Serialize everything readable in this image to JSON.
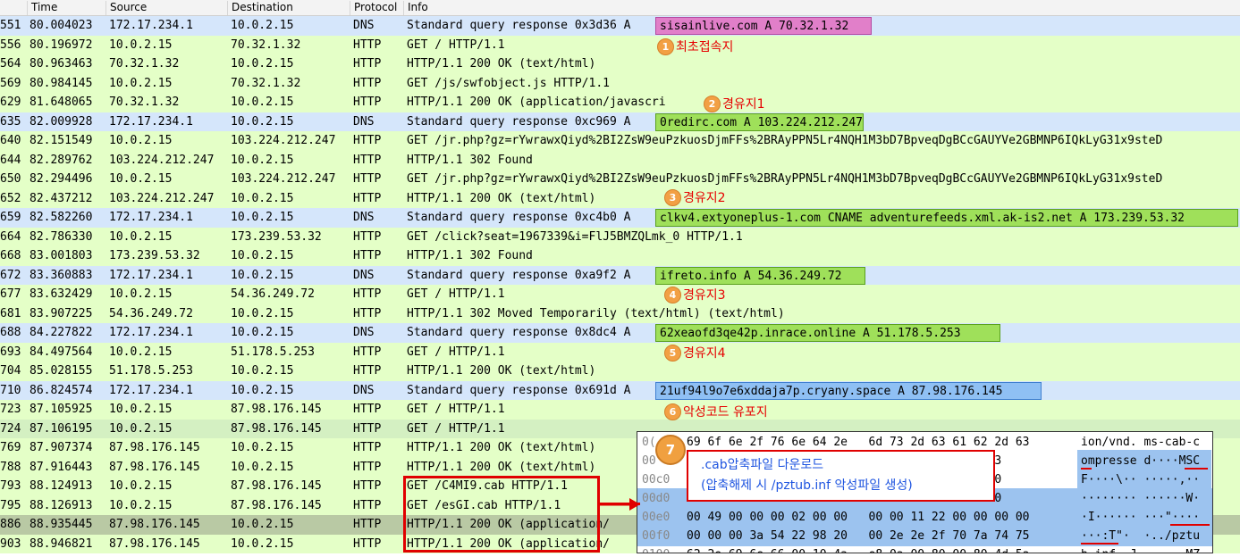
{
  "columns": {
    "no": "",
    "time": "Time",
    "source": "Source",
    "destination": "Destination",
    "protocol": "Protocol",
    "info": "Info"
  },
  "packets": [
    {
      "no": "551",
      "time": "80.004023",
      "src": "172.17.234.1",
      "dst": "10.0.2.15",
      "proto": "DNS",
      "info": "Standard query response 0x3d36 A",
      "hl_text": "sisainlive.com A 70.32.1.32",
      "bg": "#d5e6fb",
      "hl": "pink"
    },
    {
      "no": "556",
      "time": "80.196972",
      "src": "10.0.2.15",
      "dst": "70.32.1.32",
      "proto": "HTTP",
      "info": "GET / HTTP/1.1",
      "bg": "#e4ffc7"
    },
    {
      "no": "564",
      "time": "80.963463",
      "src": "70.32.1.32",
      "dst": "10.0.2.15",
      "proto": "HTTP",
      "info": "HTTP/1.1 200 OK  (text/html)",
      "bg": "#e4ffc7"
    },
    {
      "no": "569",
      "time": "80.984145",
      "src": "10.0.2.15",
      "dst": "70.32.1.32",
      "proto": "HTTP",
      "info": "GET /js/swfobject.js HTTP/1.1",
      "bg": "#e4ffc7"
    },
    {
      "no": "629",
      "time": "81.648065",
      "src": "70.32.1.32",
      "dst": "10.0.2.15",
      "proto": "HTTP",
      "info": "HTTP/1.1 200 OK  (application/javascri",
      "bg": "#e4ffc7"
    },
    {
      "no": "635",
      "time": "82.009928",
      "src": "172.17.234.1",
      "dst": "10.0.2.15",
      "proto": "DNS",
      "info": "Standard query response 0xc969 A",
      "hl_text": "0redirc.com A 103.224.212.247",
      "bg": "#d5e6fb",
      "hl": "green"
    },
    {
      "no": "640",
      "time": "82.151549",
      "src": "10.0.2.15",
      "dst": "103.224.212.247",
      "proto": "HTTP",
      "info": "GET /jr.php?gz=rYwrawxQiyd%2BI2ZsW9euPzkuosDjmFFs%2BRAyPPN5Lr4NQH1M3bD7BpveqDgBCcGAUYVe2GBMNP6IQkLyG31x9steD",
      "bg": "#e4ffc7"
    },
    {
      "no": "644",
      "time": "82.289762",
      "src": "103.224.212.247",
      "dst": "10.0.2.15",
      "proto": "HTTP",
      "info": "HTTP/1.1 302 Found",
      "bg": "#e4ffc7"
    },
    {
      "no": "650",
      "time": "82.294496",
      "src": "10.0.2.15",
      "dst": "103.224.212.247",
      "proto": "HTTP",
      "info": "GET /jr.php?gz=rYwrawxQiyd%2BI2ZsW9euPzkuosDjmFFs%2BRAyPPN5Lr4NQH1M3bD7BpveqDgBCcGAUYVe2GBMNP6IQkLyG31x9steD",
      "bg": "#e4ffc7"
    },
    {
      "no": "652",
      "time": "82.437212",
      "src": "103.224.212.247",
      "dst": "10.0.2.15",
      "proto": "HTTP",
      "info": "HTTP/1.1 200 OK  (text/html)",
      "bg": "#e4ffc7"
    },
    {
      "no": "659",
      "time": "82.582260",
      "src": "172.17.234.1",
      "dst": "10.0.2.15",
      "proto": "DNS",
      "info": "Standard query response 0xc4b0 A",
      "hl_text": "clkv4.extyoneplus-1.com CNAME adventurefeeds.xml.ak-is2.net A 173.239.53.32",
      "bg": "#d5e6fb",
      "hl": "green"
    },
    {
      "no": "664",
      "time": "82.786330",
      "src": "10.0.2.15",
      "dst": "173.239.53.32",
      "proto": "HTTP",
      "info": "GET /click?seat=1967339&i=FlJ5BMZQLmk_0 HTTP/1.1",
      "bg": "#e4ffc7"
    },
    {
      "no": "668",
      "time": "83.001803",
      "src": "173.239.53.32",
      "dst": "10.0.2.15",
      "proto": "HTTP",
      "info": "HTTP/1.1 302 Found",
      "bg": "#e4ffc7"
    },
    {
      "no": "672",
      "time": "83.360883",
      "src": "172.17.234.1",
      "dst": "10.0.2.15",
      "proto": "DNS",
      "info": "Standard query response 0xa9f2 A",
      "hl_text": "ifreto.info A 54.36.249.72",
      "bg": "#d5e6fb",
      "hl": "green"
    },
    {
      "no": "677",
      "time": "83.632429",
      "src": "10.0.2.15",
      "dst": "54.36.249.72",
      "proto": "HTTP",
      "info": "GET / HTTP/1.1",
      "bg": "#e4ffc7"
    },
    {
      "no": "681",
      "time": "83.907225",
      "src": "54.36.249.72",
      "dst": "10.0.2.15",
      "proto": "HTTP",
      "info": "HTTP/1.1 302 Moved Temporarily  (text/html) (text/html)",
      "bg": "#e4ffc7"
    },
    {
      "no": "688",
      "time": "84.227822",
      "src": "172.17.234.1",
      "dst": "10.0.2.15",
      "proto": "DNS",
      "info": "Standard query response 0x8dc4 A",
      "hl_text": "62xeaofd3qe42p.inrace.online A 51.178.5.253",
      "bg": "#d5e6fb",
      "hl": "green"
    },
    {
      "no": "693",
      "time": "84.497564",
      "src": "10.0.2.15",
      "dst": "51.178.5.253",
      "proto": "HTTP",
      "info": "GET / HTTP/1.1",
      "bg": "#e4ffc7"
    },
    {
      "no": "704",
      "time": "85.028155",
      "src": "51.178.5.253",
      "dst": "10.0.2.15",
      "proto": "HTTP",
      "info": "HTTP/1.1 200 OK  (text/html)",
      "bg": "#e4ffc7"
    },
    {
      "no": "710",
      "time": "86.824574",
      "src": "172.17.234.1",
      "dst": "10.0.2.15",
      "proto": "DNS",
      "info": "Standard query response 0x691d A",
      "hl_text": "21uf94l9o7e6xddaja7p.cryany.space A 87.98.176.145",
      "bg": "#d5e6fb",
      "hl": "blue"
    },
    {
      "no": "723",
      "time": "87.105925",
      "src": "10.0.2.15",
      "dst": "87.98.176.145",
      "proto": "HTTP",
      "info": "GET / HTTP/1.1",
      "bg": "#e4ffc7"
    },
    {
      "no": "724",
      "time": "87.106195",
      "src": "10.0.2.15",
      "dst": "87.98.176.145",
      "proto": "HTTP",
      "info": "GET / HTTP/1.1",
      "bg": "#d4f0c2"
    },
    {
      "no": "769",
      "time": "87.907374",
      "src": "87.98.176.145",
      "dst": "10.0.2.15",
      "proto": "HTTP",
      "info": "HTTP/1.1 200 OK  (text/html)",
      "bg": "#e4ffc7"
    },
    {
      "no": "788",
      "time": "87.916443",
      "src": "87.98.176.145",
      "dst": "10.0.2.15",
      "proto": "HTTP",
      "info": "HTTP/1.1 200 OK  (text/html)",
      "bg": "#e4ffc7"
    },
    {
      "no": "793",
      "time": "88.124913",
      "src": "10.0.2.15",
      "dst": "87.98.176.145",
      "proto": "HTTP",
      "info": "GET /C4MI9.cab HTTP/1.1",
      "bg": "#e4ffc7"
    },
    {
      "no": "795",
      "time": "88.126913",
      "src": "10.0.2.15",
      "dst": "87.98.176.145",
      "proto": "HTTP",
      "info": "GET /esGI.cab HTTP/1.1",
      "bg": "#e4ffc7"
    },
    {
      "no": "886",
      "time": "88.935445",
      "src": "87.98.176.145",
      "dst": "10.0.2.15",
      "proto": "HTTP",
      "info": "HTTP/1.1 200 OK  (application/",
      "bg": "#b9c9a4"
    },
    {
      "no": "903",
      "time": "88.946821",
      "src": "87.98.176.145",
      "dst": "10.0.2.15",
      "proto": "HTTP",
      "info": "HTTP/1.1 200 OK  (application/",
      "bg": "#e4ffc7"
    }
  ],
  "annotations": [
    {
      "num": "1",
      "text": "최초접속지"
    },
    {
      "num": "2",
      "text": "경유지1"
    },
    {
      "num": "3",
      "text": "경유지2"
    },
    {
      "num": "4",
      "text": "경유지3"
    },
    {
      "num": "5",
      "text": "경유지4"
    },
    {
      "num": "6",
      "text": "악성코드 유포지"
    }
  ],
  "hexdump": {
    "rows": [
      {
        "off": "0(",
        "bytes": "69 6f 6e 2f 76 6e 64 2e   6d 73 2d 63 61 62 2d 63",
        "ascii": "ion/vnd. ms-cab-c"
      },
      {
        "off": "00",
        "bytes": "                                     4d 53 43",
        "ascii": "ompresse d····MSC"
      },
      {
        "off": "00c0",
        "bytes": "                                     2c 00 00",
        "ascii": "F····\\·· ·····,··"
      },
      {
        "off": "00d0",
        "bytes": "                                     57 04 00",
        "ascii": "········ ······W·"
      },
      {
        "off": "00e0",
        "bytes": "00 49 00 00 00 02 00 00   00 00 11 22 00 00 00 00",
        "ascii": "·I······ ···\"····"
      },
      {
        "off": "00f0",
        "bytes": "00 00 00 3a 54 22 98 20   00 2e 2e 2f 70 7a 74 75",
        "ascii": "···:T\"·  ·../pztu"
      },
      {
        "off": "0100",
        "bytes": "62 2e 69 6e 66 00 10 4a   e8 0a 00 80 00 80 4d 5a",
        "ascii": "b.inf··J ······MZ"
      }
    ],
    "badge": "7",
    "callout_line1": ".cab압축파일 다운로드",
    "callout_line2": "(압축해제 시 /pztub.inf 악성파일 생성)"
  },
  "colors": {
    "dns_row": "#d5e6fb",
    "http_row": "#e4ffc7",
    "accent_red": "#e00000",
    "badge_orange": "#f2a044"
  }
}
